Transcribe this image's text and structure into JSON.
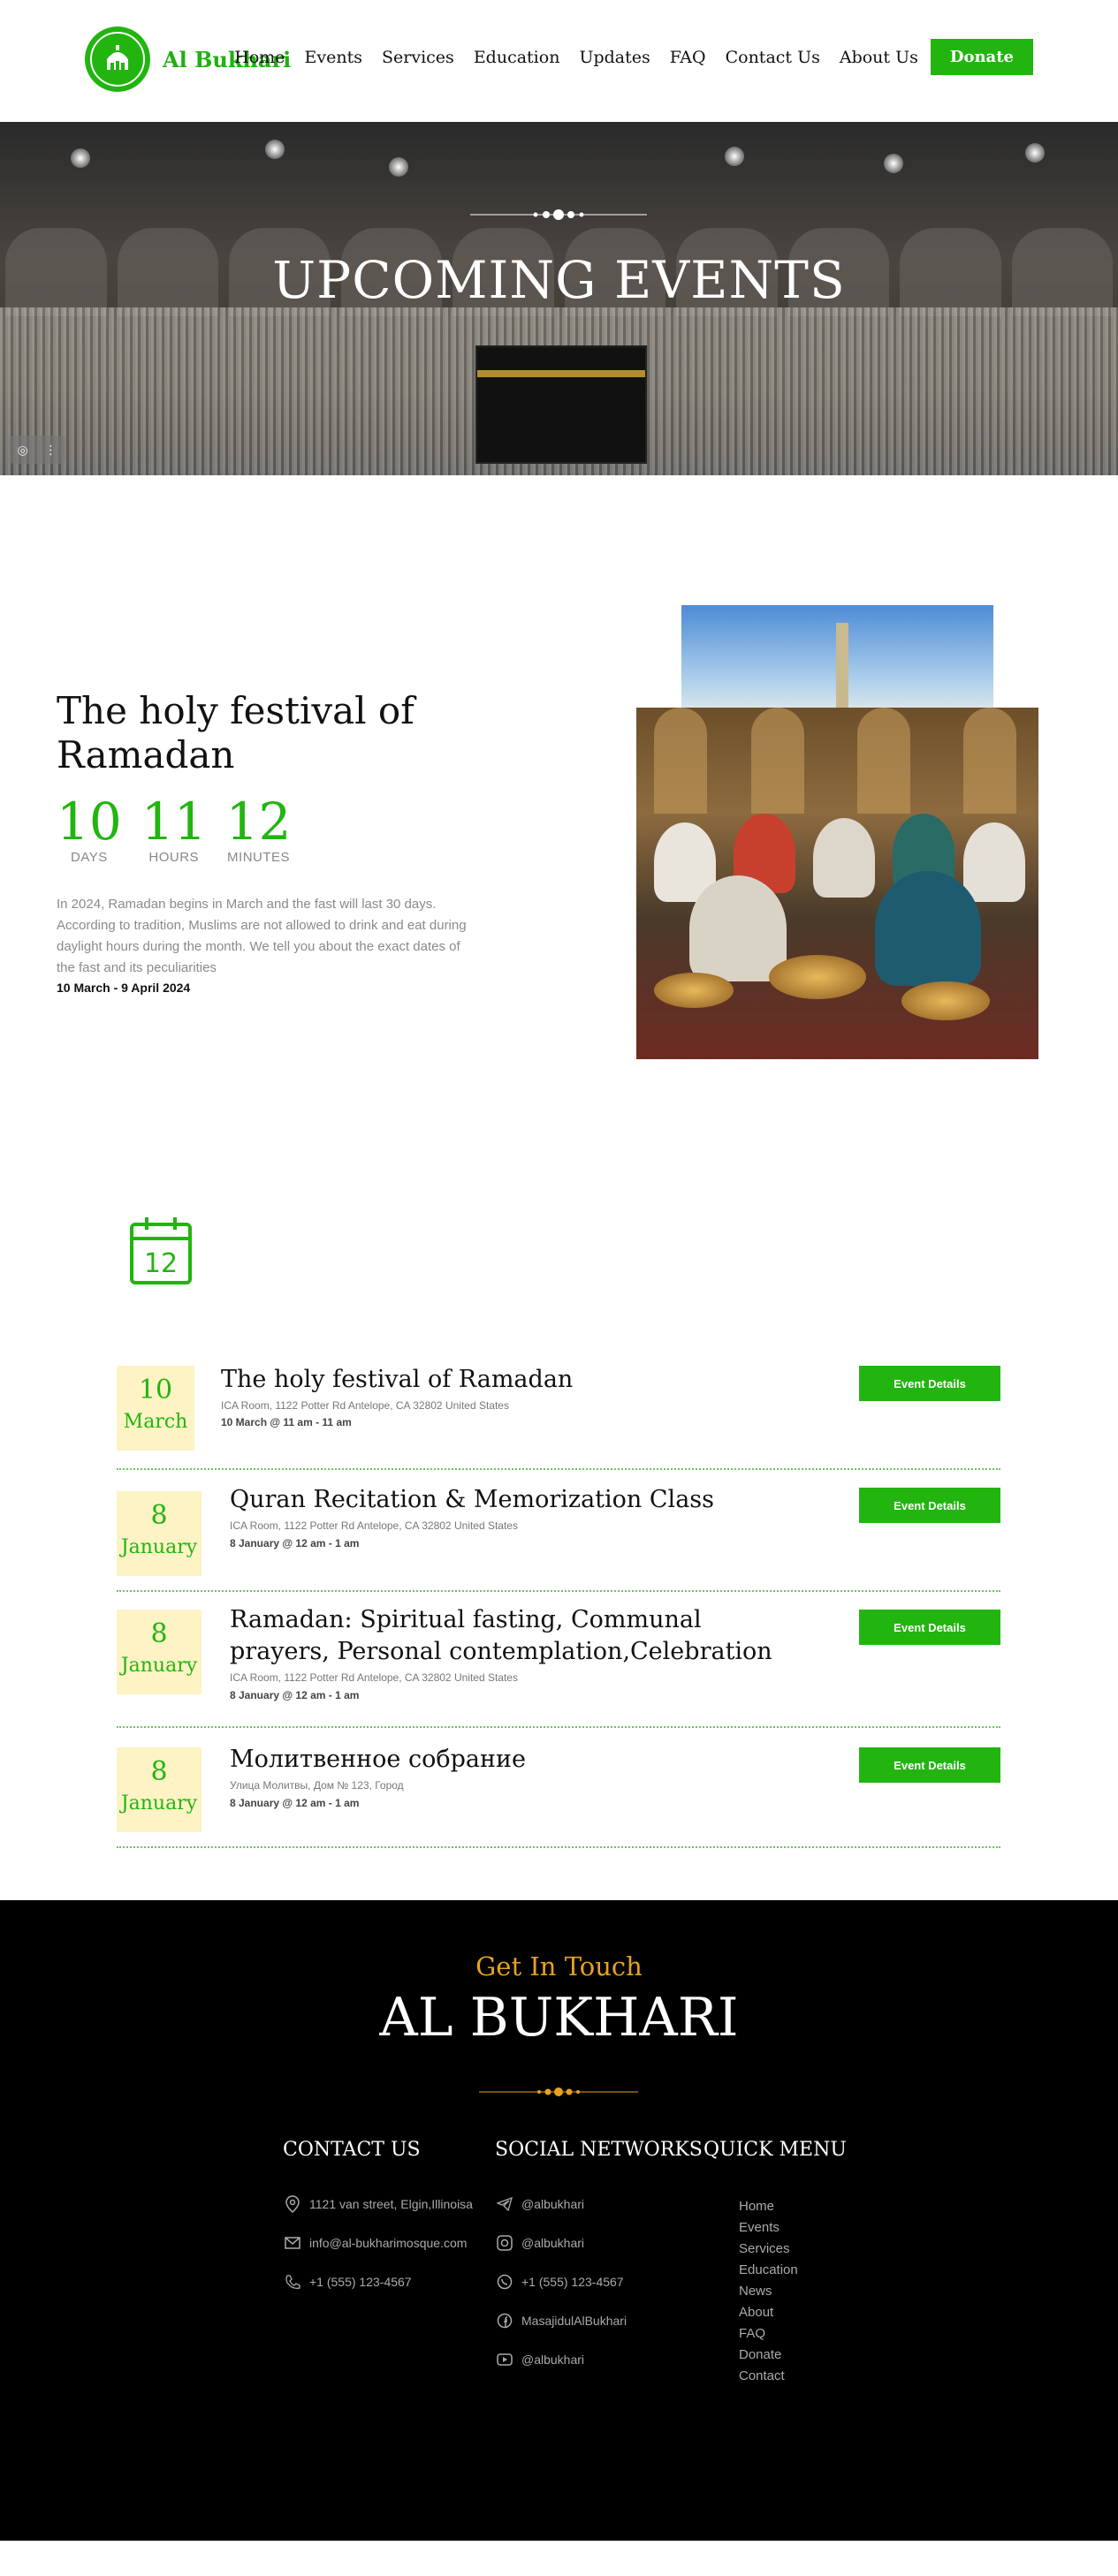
{
  "header": {
    "brand": "Al Bukhari",
    "nav": [
      "Home",
      "Events",
      "Services",
      "Education",
      "Updates",
      "FAQ",
      "Contact Us",
      "About Us"
    ],
    "donate_label": "Donate"
  },
  "hero": {
    "title": "UPCOMING EVENTS"
  },
  "feature": {
    "title": "The holy festival of Ramadan",
    "countdown": [
      {
        "value": "10",
        "label": "DAYS"
      },
      {
        "value": "11",
        "label": "HOURS"
      },
      {
        "value": "12",
        "label": "MINUTES"
      }
    ],
    "description": "In 2024, Ramadan begins in March and the fast will last 30 days. According to tradition, Muslims are not allowed to drink and eat during daylight hours during the month. We tell you about the exact dates of the fast and its peculiarities",
    "date_range": "10 March - 9 April 2024"
  },
  "events": {
    "calendar_icon_number": "12",
    "items": [
      {
        "day": "10",
        "month": "March",
        "title": "The holy festival of Ramadan",
        "location": "ICA Room, 1122 Potter Rd Antelope, CA 32802 United States",
        "time": "10 March @ 11 am - 11 am",
        "button": "Event Details"
      },
      {
        "day": "8",
        "month": "January",
        "title": "Quran Recitation & Memorization Class",
        "location": "ICA Room, 1122 Potter Rd Antelope, CA 32802 United States",
        "time": "8 January @ 12 am - 1 am",
        "button": "Event Details"
      },
      {
        "day": "8",
        "month": "January",
        "title": "Ramadan: Spiritual fasting, Communal prayers, Personal contemplation,Celebration",
        "location": "ICA Room, 1122 Potter Rd Antelope, CA 32802 United States",
        "time": "8 January @ 12 am - 1 am",
        "button": "Event Details"
      },
      {
        "day": "8",
        "month": "January",
        "title": "Молитвенное собрание",
        "location": "Улица Молитвы, Дом № 123, Город",
        "time": "8 January @ 12 am - 1 am",
        "button": "Event Details"
      }
    ]
  },
  "footer": {
    "subtitle": "Get In Touch",
    "title": "AL BUKHARI",
    "contact_heading": "CONTACT US",
    "contact": [
      {
        "icon": "location-pin-icon",
        "text": "1121 van street, Elgin,Illinoisa"
      },
      {
        "icon": "mail-icon",
        "text": "info@al-bukharimosque.com"
      },
      {
        "icon": "phone-icon",
        "text": "+1 (555) 123-4567"
      }
    ],
    "social_heading": "SOCIAL NETWORKS",
    "social": [
      {
        "icon": "telegram-icon",
        "text": "@albukhari"
      },
      {
        "icon": "instagram-icon",
        "text": "@albukhari"
      },
      {
        "icon": "whatsapp-icon",
        "text": "+1 (555) 123-4567"
      },
      {
        "icon": "facebook-icon",
        "text": "MasajidulAlBukhari"
      },
      {
        "icon": "youtube-icon",
        "text": "@albukhari"
      }
    ],
    "menu_heading": "QUICK MENU",
    "menu": [
      "Home",
      "Events",
      "Services",
      "Education",
      "News",
      "About",
      "FAQ",
      "Donate",
      "Contact"
    ]
  },
  "colors": {
    "brand_green": "#22b510",
    "accent_gold": "#e6a21f",
    "date_box": "#fdf3c4"
  }
}
